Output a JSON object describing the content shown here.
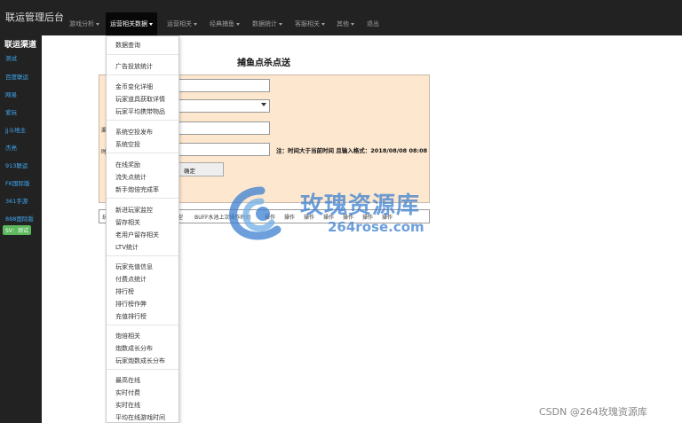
{
  "header": {
    "brand": "联运管理后台",
    "nav": [
      {
        "label": "游戏分析"
      },
      {
        "label": "运营相关数据"
      },
      {
        "label": "运营相关"
      },
      {
        "label": "经典捕鱼"
      },
      {
        "label": "数据统计"
      },
      {
        "label": "客服相关"
      },
      {
        "label": "其他"
      },
      {
        "label": "退出"
      }
    ]
  },
  "sidebar": {
    "title": "联运渠道",
    "items": [
      {
        "label": "测试"
      },
      {
        "label": "百度联运"
      },
      {
        "label": "网易"
      },
      {
        "label": "爱玩"
      },
      {
        "label": "jj斗地主"
      },
      {
        "label": "杰亮"
      },
      {
        "label": "913联运"
      },
      {
        "label": "FK国际版"
      },
      {
        "label": "361手游"
      },
      {
        "label": "888国际版"
      }
    ],
    "badge": "SV：测试"
  },
  "main": {
    "title": "捕鱼点杀点送",
    "form": {
      "note": "注：时间大于当前时间 且输入格式：2018/08/08 08:08",
      "ok_label": "确定",
      "row_labels": {
        "r3": "渠",
        "r4": "时"
      }
    },
    "table_headers": {
      "first": "玩",
      "type_col": "型",
      "buff_col": "BUFF水池上次操作时间",
      "c4": "操作",
      "c5": "操作",
      "c6": "操作",
      "c7": "操作",
      "c8": "操作",
      "c9": "操作",
      "c10": "操作"
    }
  },
  "dropdown": {
    "groups": [
      [
        "数据查询"
      ],
      [
        "广告投放统计"
      ],
      [
        "金币变化详细",
        "玩家道具获取详情",
        "玩家平均携带物品"
      ],
      [
        "系统空投发布",
        "系统空投"
      ],
      [
        "在线奖励",
        "流失点统计",
        "新手炮倍完成率"
      ],
      [
        "新进玩家监控",
        "留存相关",
        "老用户留存相关",
        "LTV统计"
      ],
      [
        "玩家充值信息",
        "付费点统计",
        "排行榜",
        "排行榜作弊",
        "充值排行榜"
      ],
      [
        "炮倍相关",
        "炮数成长分布",
        "玩家炮数成长分布"
      ],
      [
        "最高在线",
        "实时付费",
        "实时在线",
        "平均在线游戏时间"
      ]
    ]
  },
  "watermark": {
    "cn": "玫瑰资源库",
    "url": "264rose.com",
    "footer": "CSDN @264玫瑰资源库"
  }
}
